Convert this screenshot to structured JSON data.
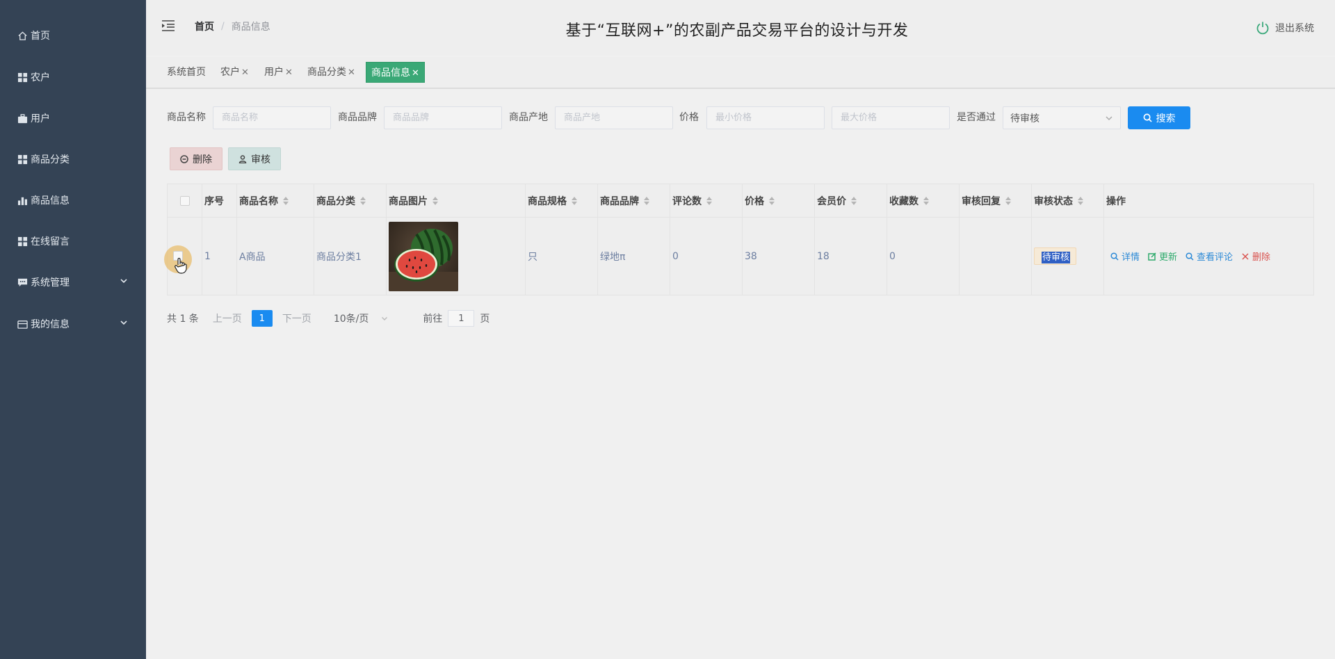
{
  "sidebar": {
    "items": [
      {
        "label": "首页",
        "icon": "home-icon"
      },
      {
        "label": "农户",
        "icon": "grid-icon"
      },
      {
        "label": "用户",
        "icon": "briefcase-icon"
      },
      {
        "label": "商品分类",
        "icon": "grid-icon"
      },
      {
        "label": "商品信息",
        "icon": "bar-chart-icon"
      },
      {
        "label": "在线留言",
        "icon": "grid-icon"
      },
      {
        "label": "系统管理",
        "icon": "chat-icon",
        "expandable": true
      },
      {
        "label": "我的信息",
        "icon": "card-icon",
        "expandable": true
      }
    ]
  },
  "header": {
    "breadcrumb_home": "首页",
    "breadcrumb_current": "商品信息",
    "title": "基于“互联网+”的农副产品交易平台的设计与开发",
    "logout": "退出系统"
  },
  "tags": [
    {
      "label": "系统首页",
      "closable": false,
      "active": false
    },
    {
      "label": "农户",
      "closable": true,
      "active": false
    },
    {
      "label": "用户",
      "closable": true,
      "active": false
    },
    {
      "label": "商品分类",
      "closable": true,
      "active": false
    },
    {
      "label": "商品信息",
      "closable": true,
      "active": true
    }
  ],
  "filters": {
    "name_label": "商品名称",
    "name_placeholder": "商品名称",
    "brand_label": "商品品牌",
    "brand_placeholder": "商品品牌",
    "origin_label": "商品产地",
    "origin_placeholder": "商品产地",
    "price_label": "价格",
    "min_price_placeholder": "最小价格",
    "max_price_placeholder": "最大价格",
    "pass_label": "是否通过",
    "pass_value": "待审核",
    "search_button": "搜索"
  },
  "actions": {
    "delete": "删除",
    "audit": "审核"
  },
  "table": {
    "columns": [
      "序号",
      "商品名称",
      "商品分类",
      "商品图片",
      "商品规格",
      "商品品牌",
      "评论数",
      "价格",
      "会员价",
      "收藏数",
      "审核回复",
      "审核状态",
      "操作"
    ],
    "rows": [
      {
        "index": "1",
        "name": "A商品",
        "category": "商品分类1",
        "image": "watermelon",
        "spec": "只",
        "brand": "绿地π",
        "comments": "0",
        "price": "38",
        "member_price": "18",
        "favorites": "0",
        "audit_reply": "",
        "audit_status": "待审核",
        "ops": {
          "detail": "详情",
          "update": "更新",
          "reviews": "查看评论",
          "delete": "删除"
        }
      }
    ]
  },
  "pagination": {
    "total": "共 1 条",
    "prev": "上一页",
    "current": "1",
    "next": "下一页",
    "page_size": "10条/页",
    "goto_label": "前往",
    "goto_value": "1",
    "goto_unit": "页"
  },
  "colors": {
    "sidebar_bg": "#344355",
    "primary": "#1a8bf0",
    "active_tag": "#3aa876",
    "update_green": "#2eaa6c",
    "delete_red": "#d9534f"
  }
}
